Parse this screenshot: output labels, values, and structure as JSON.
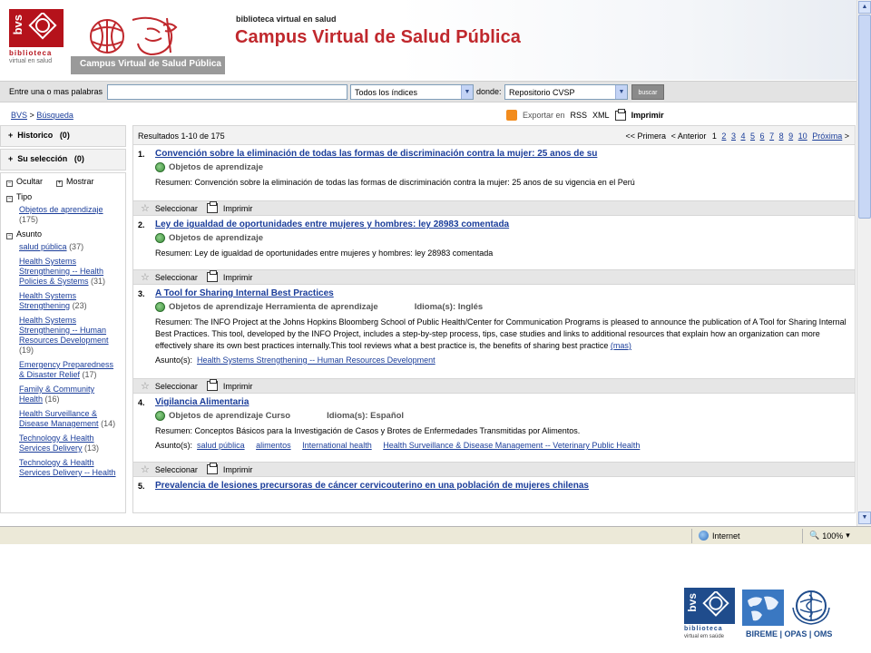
{
  "header": {
    "site_small": "biblioteca virtual en salud",
    "title": "Campus Virtual de Salud Pública",
    "bvs_logo_text": "bvs",
    "bvs_caption": "biblioteca",
    "bvs_caption_sub": "virtual en salud",
    "cvsp_strip": "Campus Virtual de Salud Pública"
  },
  "search": {
    "label": "Entre una o mas palabras",
    "input_value": "",
    "index_select": "Todos los índices",
    "where_label": "donde:",
    "where_select": "Repositorio CVSP",
    "button": "buscar"
  },
  "breadcrumb": {
    "home": "BVS",
    "sep": ">",
    "current": "Búsqueda"
  },
  "export": {
    "label": "Exportar en",
    "rss": "RSS",
    "xml": "XML",
    "print": "Imprimir"
  },
  "sidebar": {
    "historico": "Historico",
    "historico_count": "(0)",
    "seleccion": "Su selección",
    "seleccion_count": "(0)",
    "ocultar": "Ocultar",
    "mostrar": "Mostrar",
    "tipo": "Tipo",
    "tipo_items": [
      {
        "label": "Objetos de aprendizaje",
        "count": "(175)"
      }
    ],
    "asunto": "Asunto",
    "asunto_items": [
      {
        "label": "salud pública",
        "count": "(37)"
      },
      {
        "label": "Health Systems Strengthening -- Health Policies & Systems",
        "count": "(31)"
      },
      {
        "label": "Health Systems Strengthening",
        "count": "(23)"
      },
      {
        "label": "Health Systems Strengthening -- Human Resources Development",
        "count": "(19)"
      },
      {
        "label": "Emergency Preparedness & Disaster Relief",
        "count": "(17)"
      },
      {
        "label": "Family & Community Health",
        "count": "(16)"
      },
      {
        "label": "Health Surveillance & Disease Management",
        "count": "(14)"
      },
      {
        "label": "Technology & Health Services Delivery",
        "count": "(13)"
      },
      {
        "label": "Technology & Health Services Delivery -- Health",
        "count": ""
      }
    ]
  },
  "results": {
    "count_label": "Resultados  1-10 de 175",
    "pager": {
      "first": "<< Primera",
      "prev": "< Anterior",
      "current": "1",
      "pages": [
        "2",
        "3",
        "4",
        "5",
        "6",
        "7",
        "8",
        "9",
        "10"
      ],
      "next": "Próxima",
      "next_arrow": ">"
    },
    "select_label": "Seleccionar",
    "print_label": "Imprimir",
    "resumen_label": "Resumen:",
    "asunto_label": "Asunto(s):",
    "items": [
      {
        "num": "1.",
        "title": "Convención sobre la eliminación de todas las formas de discriminación contra la mujer: 25 anos de su",
        "type": "Objetos de aprendizaje",
        "abstract": "Convención sobre la eliminación de todas las formas de discriminación contra la mujer: 25 anos de su vigencia en el Perú"
      },
      {
        "num": "2.",
        "title": "Ley de igualdad de oportunidades entre mujeres y hombres: ley 28983 comentada",
        "type": "Objetos de aprendizaje",
        "abstract": "Ley de igualdad de oportunidades entre mujeres y hombres: ley 28983 comentada"
      },
      {
        "num": "3.",
        "title": "A Tool for Sharing Internal Best Practices",
        "type": "Objetos de aprendizaje Herramienta de aprendizaje",
        "lang": "Idioma(s): Inglés",
        "abstract": "The INFO Project at the Johns Hopkins Bloomberg School of Public Health/Center for Communication Programs is pleased to announce the publication of A Tool for Sharing Internal Best Practices. This tool, developed by the INFO Project, includes a step-by-step process, tips, case studies and links to additional resources that explain how an organization can more effectively share its own best practices internally.This tool reviews what a best practice is, the benefits of sharing best practice",
        "more": "(mas)",
        "subjects": [
          "Health Systems Strengthening -- Human Resources Development"
        ]
      },
      {
        "num": "4.",
        "title": "Vigilancia Alimentaria",
        "type": "Objetos de aprendizaje Curso",
        "lang": "Idioma(s): Español",
        "abstract": "Conceptos Básicos para la Investigación de Casos y Brotes de Enfermedades Transmitidas por Alimentos.",
        "subjects": [
          "salud pública",
          "alimentos",
          "International health",
          "Health Surveillance & Disease Management -- Veterinary Public Health"
        ]
      },
      {
        "num": "5.",
        "title": "Prevalencia de lesiones precursoras de cáncer cervicouterino en una población de mujeres chilenas"
      }
    ]
  },
  "statusbar": {
    "zone": "Internet",
    "zoom": "100%"
  },
  "footer": {
    "bvs": "bvs",
    "caption": "biblioteca",
    "caption_sub": "virtual em saúde",
    "orgs": "BIREME | OPAS | OMS"
  },
  "colors": {
    "brand_red": "#c0282d",
    "link_blue": "#1a3d9a",
    "footer_blue": "#1f4c8c"
  }
}
